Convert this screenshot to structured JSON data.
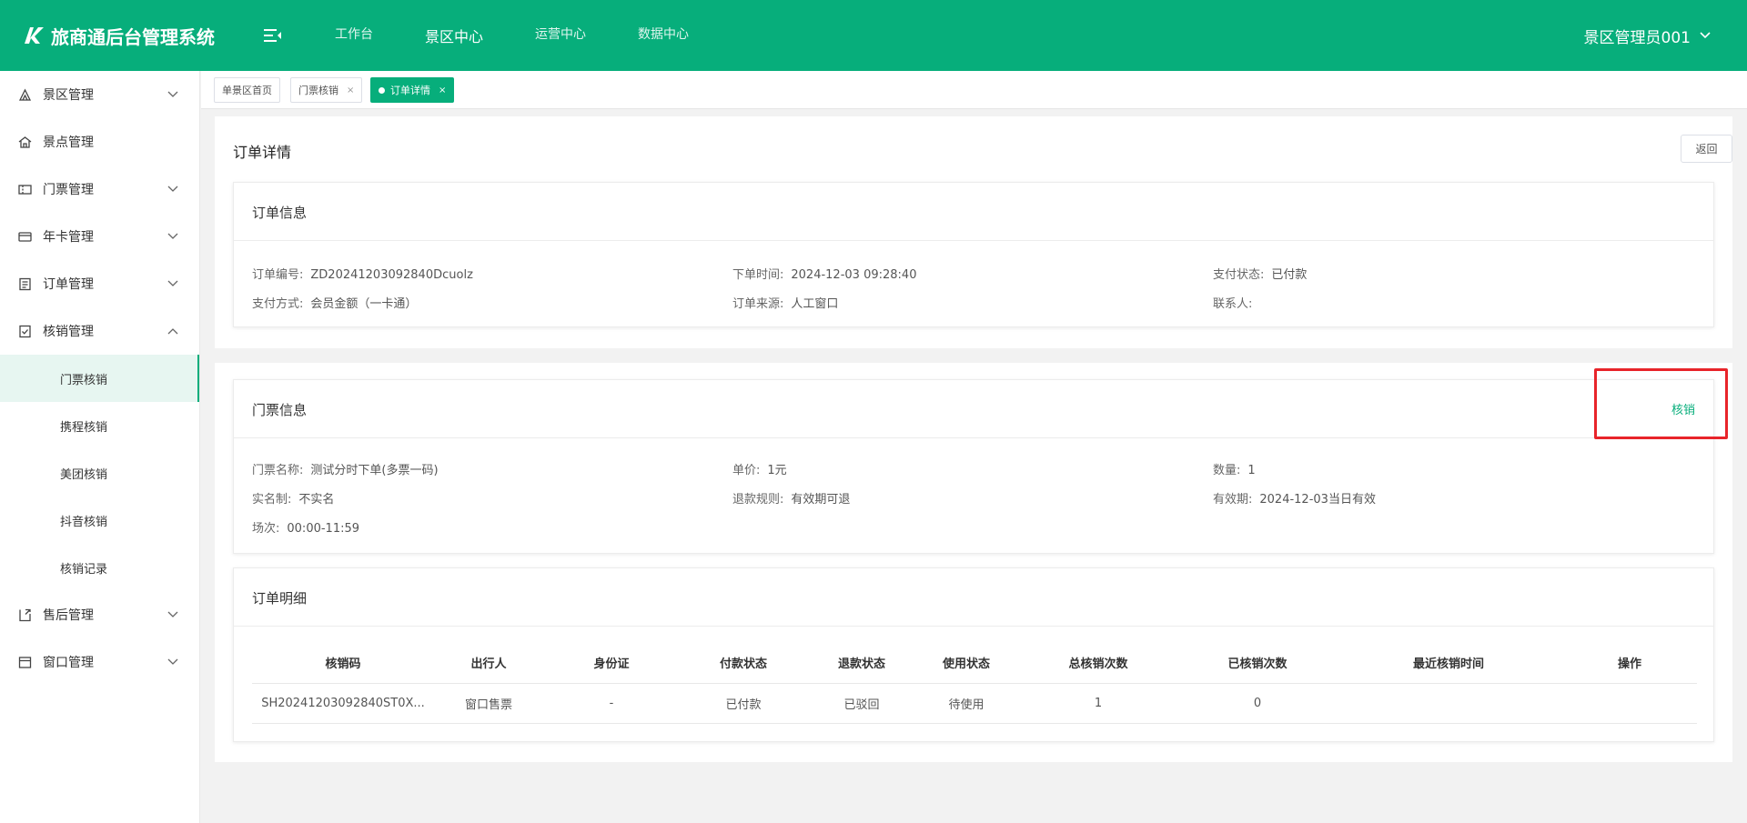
{
  "app": {
    "title": "旅商通后台管理系统"
  },
  "topnav": [
    "工作台",
    "景区中心",
    "运营中心",
    "数据中心"
  ],
  "user": {
    "name": "景区管理员001"
  },
  "sidebar": {
    "items": [
      {
        "label": "景区管理",
        "icon": "scenic-area-icon"
      },
      {
        "label": "景点管理",
        "icon": "attraction-icon"
      },
      {
        "label": "门票管理",
        "icon": "ticket-icon"
      },
      {
        "label": "年卡管理",
        "icon": "card-icon"
      },
      {
        "label": "订单管理",
        "icon": "order-icon"
      },
      {
        "label": "核销管理",
        "icon": "verify-icon"
      },
      {
        "label": "售后管理",
        "icon": "after-sales-icon"
      },
      {
        "label": "窗口管理",
        "icon": "window-icon"
      }
    ],
    "subitems": [
      "门票核销",
      "携程核销",
      "美团核销",
      "抖音核销",
      "核销记录"
    ]
  },
  "tabs": [
    {
      "label": "单景区首页"
    },
    {
      "label": "门票核销",
      "close": "×"
    },
    {
      "label": "订单详情",
      "close": "×"
    }
  ],
  "page": {
    "title": "订单详情",
    "back_label": "返回"
  },
  "order_info": {
    "title": "订单信息",
    "fields": [
      {
        "label": "订单编号:",
        "value": "ZD20241203092840Dcuolz"
      },
      {
        "label": "下单时间:",
        "value": "2024-12-03 09:28:40"
      },
      {
        "label": "支付状态:",
        "value": "已付款"
      },
      {
        "label": "支付方式:",
        "value": "会员金额（一卡通）"
      },
      {
        "label": "订单来源:",
        "value": "人工窗口"
      },
      {
        "label": "联系人:",
        "value": ""
      }
    ]
  },
  "ticket_info": {
    "title": "门票信息",
    "action_label": "核销",
    "fields": [
      {
        "label": "门票名称:",
        "value": "测试分时下单(多票一码)"
      },
      {
        "label": "单价:",
        "value": "1元"
      },
      {
        "label": "数量:",
        "value": "1"
      },
      {
        "label": "实名制:",
        "value": "不实名"
      },
      {
        "label": "退款规则:",
        "value": "有效期可退"
      },
      {
        "label": "有效期:",
        "value": "2024-12-03当日有效"
      },
      {
        "label": "场次:",
        "value": "00:00-11:59"
      }
    ]
  },
  "order_detail": {
    "title": "订单明细",
    "columns": [
      "核销码",
      "出行人",
      "身份证",
      "付款状态",
      "退款状态",
      "使用状态",
      "总核销次数",
      "已核销次数",
      "最近核销时间",
      "操作"
    ],
    "rows": [
      [
        "SH20241203092840ST0X...",
        "窗口售票",
        "-",
        "已付款",
        "已驳回",
        "待使用",
        "1",
        "0",
        "",
        ""
      ]
    ]
  },
  "colors": {
    "brand": "#07ae7b",
    "highlight": "#e8242a"
  }
}
